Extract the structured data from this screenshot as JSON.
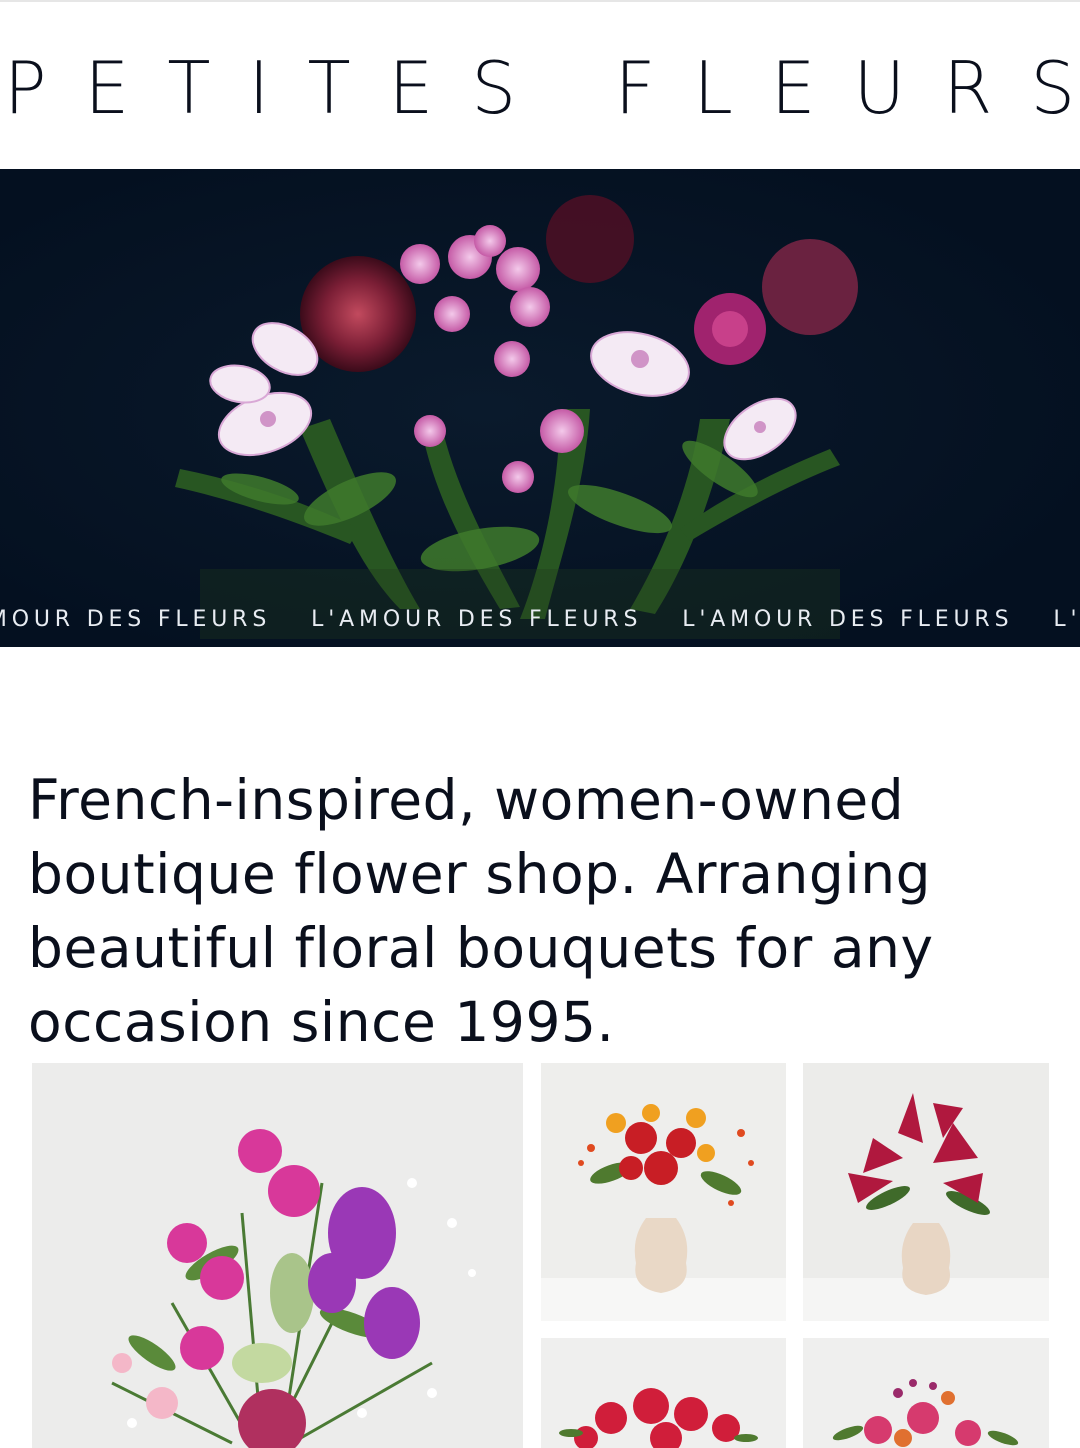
{
  "brand": {
    "logo_text": "PETITES FLEURS"
  },
  "hero": {
    "image_alt": "Bouquet of alstroemeria, pink chrysanthemums and allium on dark background",
    "marquee": [
      "L'AMOUR DES FLEURS",
      "L'AMOUR DES FLEURS",
      "L'AMOUR DES FLEURS",
      "L'AMOUR DES FLEURS"
    ]
  },
  "intro": {
    "tagline": "French-inspired, women-owned boutique flower shop. Arranging beautiful floral bouquets for any occasion since 1995."
  },
  "gallery": {
    "items": [
      {
        "name": "bouquet-pink-purple"
      },
      {
        "name": "bouquet-autumn-vase"
      },
      {
        "name": "bouquet-red-lilies-vase"
      },
      {
        "name": "bouquet-red-roses"
      },
      {
        "name": "bouquet-mixed-pink"
      }
    ]
  },
  "colors": {
    "hero_background": "#051221",
    "text": "#0a0f1c",
    "marquee_text": "#e8ecf2"
  }
}
